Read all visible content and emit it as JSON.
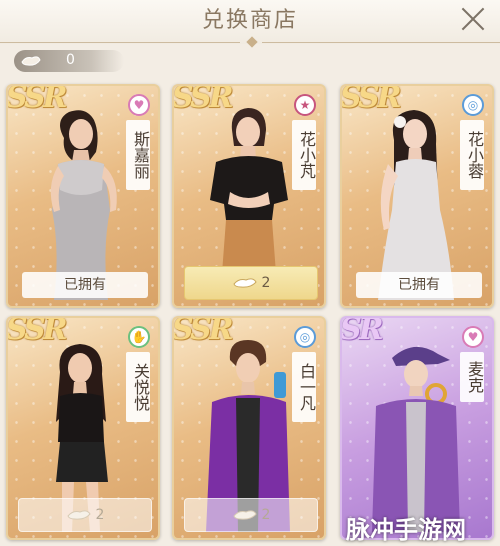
{
  "header": {
    "title": "兑换商店"
  },
  "currency": {
    "icon": "token-icon",
    "value": "0"
  },
  "cards": [
    {
      "rarity": "SSR",
      "name": "斯嘉丽",
      "badge_icon": "heart-icon",
      "badge_glyph": "♥",
      "badge_color": "#d97bb6",
      "status": "已拥有",
      "price": null
    },
    {
      "rarity": "SSR",
      "name": "花小芃",
      "badge_icon": "star-icon",
      "badge_glyph": "★",
      "badge_color": "#c7557e",
      "status": null,
      "price": "2"
    },
    {
      "rarity": "SSR",
      "name": "花小蓉",
      "badge_icon": "circle-icon",
      "badge_glyph": "◎",
      "badge_color": "#5b9bd8",
      "status": "已拥有",
      "price": null
    },
    {
      "rarity": "SSR",
      "name": "关悦悦",
      "badge_icon": "foot-icon",
      "badge_glyph": "✋",
      "badge_color": "#6cc07e",
      "status": null,
      "price": "2"
    },
    {
      "rarity": "SSR",
      "name": "白一凡",
      "badge_icon": "circle-icon",
      "badge_glyph": "◎",
      "badge_color": "#5b9bd8",
      "status": null,
      "price": "2"
    },
    {
      "rarity": "SR",
      "name": "麦克",
      "badge_icon": "heart-icon",
      "badge_glyph": "♥",
      "badge_color": "#d97bb6",
      "status": null,
      "price": null
    }
  ],
  "watermark": "脉冲手游网"
}
